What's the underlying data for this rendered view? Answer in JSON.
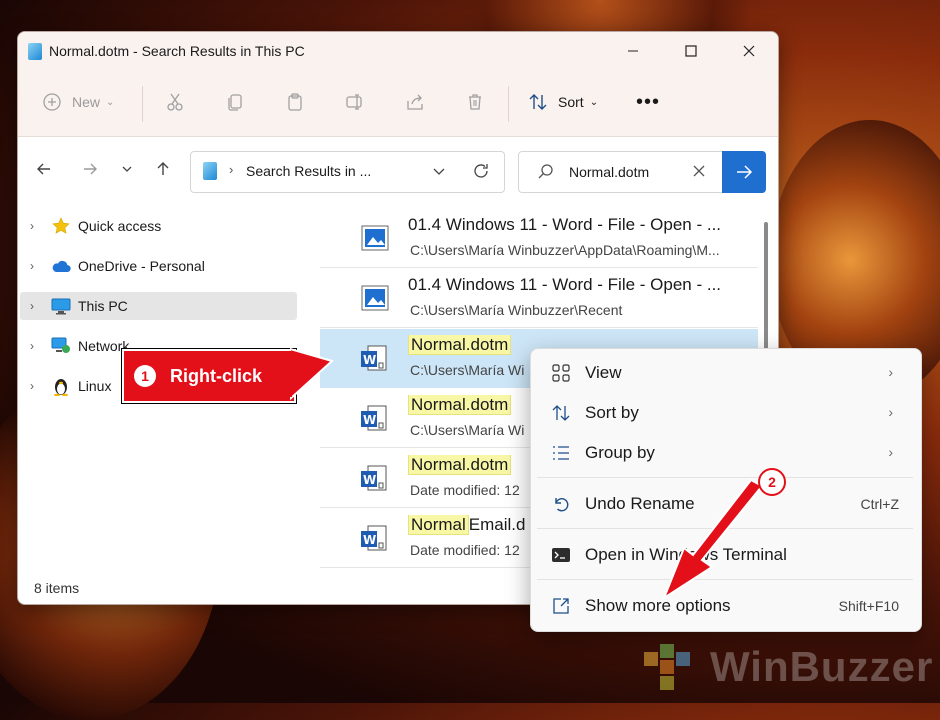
{
  "window": {
    "title": "Normal.dotm - Search Results in This PC"
  },
  "toolbar": {
    "new_label": "New",
    "sort_label": "Sort",
    "more_label": "•••"
  },
  "address": {
    "text": "Search Results in ..."
  },
  "search": {
    "value": "Normal.dotm"
  },
  "sidebar": {
    "items": [
      {
        "label": "Quick access",
        "icon": "star-icon"
      },
      {
        "label": "OneDrive - Personal",
        "icon": "cloud-icon"
      },
      {
        "label": "This PC",
        "icon": "computer-icon",
        "selected": true
      },
      {
        "label": "Network",
        "icon": "network-icon"
      },
      {
        "label": "Linux",
        "icon": "linux-penguin-icon"
      }
    ]
  },
  "files": [
    {
      "name": "01.4 Windows 11 - Word - File - Open - ...",
      "path": "C:\\Users\\María Winbuzzer\\AppData\\Roaming\\M...",
      "icon": "image-file-icon"
    },
    {
      "name": "01.4 Windows 11 - Word - File - Open - ...",
      "path": "C:\\Users\\María Winbuzzer\\Recent",
      "icon": "image-file-icon"
    },
    {
      "name": "Normal.dotm",
      "path": "C:\\Users\\María Wi",
      "icon": "word-template-icon",
      "selected": true
    },
    {
      "name": "Normal.dotm",
      "path": "C:\\Users\\María Wi",
      "icon": "word-template-icon"
    },
    {
      "name": "Normal.dotm",
      "path": "Date modified: 12",
      "icon": "word-template-icon"
    },
    {
      "name_hl": "Normal",
      "name_rest": "Email.d",
      "path": "Date modified: 12",
      "icon": "word-template-icon"
    }
  ],
  "status": {
    "items": "8 items"
  },
  "context_menu": {
    "view": "View",
    "sort_by": "Sort by",
    "group_by": "Group by",
    "undo_rename": "Undo Rename",
    "undo_rename_key": "Ctrl+Z",
    "open_terminal": "Open in Windows Terminal",
    "show_more": "Show more options",
    "show_more_key": "Shift+F10"
  },
  "annotations": {
    "step1_number": "1",
    "step1_label": "Right-click",
    "step2_number": "2",
    "accent": "#e3101a"
  },
  "watermark": {
    "text": "WinBuzzer"
  },
  "colors": {
    "accent_blue": "#1f6fd1",
    "selection": "#cde6f7",
    "highlight": "#f7f7a6"
  }
}
